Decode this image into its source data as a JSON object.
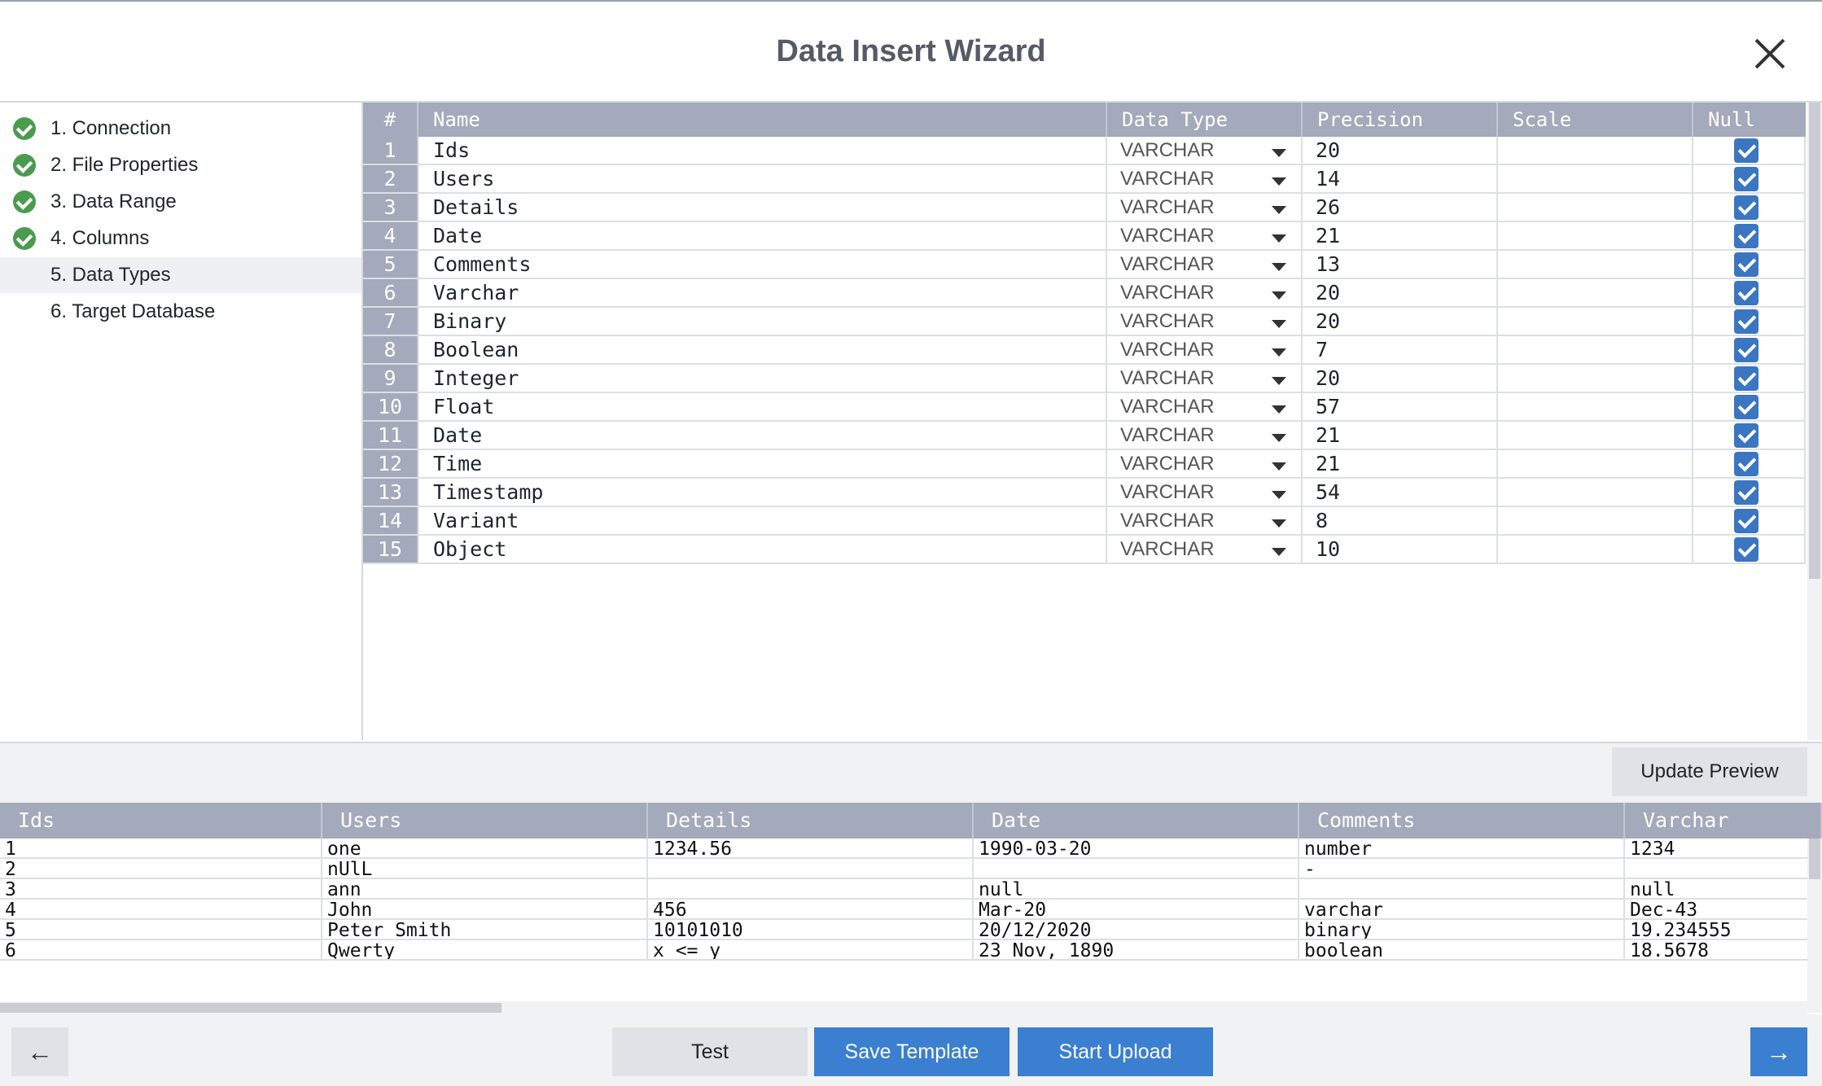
{
  "window": {
    "title": "Data Insert Wizard"
  },
  "steps": [
    {
      "label": "1. Connection",
      "done": true
    },
    {
      "label": "2. File Properties",
      "done": true
    },
    {
      "label": "3. Data Range",
      "done": true
    },
    {
      "label": "4. Columns",
      "done": true
    },
    {
      "label": "5. Data Types",
      "done": false,
      "active": true
    },
    {
      "label": "6. Target Database",
      "done": false
    }
  ],
  "columns_grid": {
    "headers": {
      "num": "#",
      "name": "Name",
      "type": "Data Type",
      "precision": "Precision",
      "scale": "Scale",
      "null": "Null"
    },
    "rows": [
      {
        "num": "1",
        "name": "Ids",
        "type": "VARCHAR",
        "precision": "20",
        "scale": "",
        "null": true
      },
      {
        "num": "2",
        "name": "Users",
        "type": "VARCHAR",
        "precision": "14",
        "scale": "",
        "null": true
      },
      {
        "num": "3",
        "name": "Details",
        "type": "VARCHAR",
        "precision": "26",
        "scale": "",
        "null": true
      },
      {
        "num": "4",
        "name": "Date",
        "type": "VARCHAR",
        "precision": "21",
        "scale": "",
        "null": true
      },
      {
        "num": "5",
        "name": "Comments",
        "type": "VARCHAR",
        "precision": "13",
        "scale": "",
        "null": true
      },
      {
        "num": "6",
        "name": "Varchar",
        "type": "VARCHAR",
        "precision": "20",
        "scale": "",
        "null": true
      },
      {
        "num": "7",
        "name": "Binary",
        "type": "VARCHAR",
        "precision": "20",
        "scale": "",
        "null": true
      },
      {
        "num": "8",
        "name": "Boolean",
        "type": "VARCHAR",
        "precision": "7",
        "scale": "",
        "null": true
      },
      {
        "num": "9",
        "name": "Integer",
        "type": "VARCHAR",
        "precision": "20",
        "scale": "",
        "null": true
      },
      {
        "num": "10",
        "name": "Float",
        "type": "VARCHAR",
        "precision": "57",
        "scale": "",
        "null": true
      },
      {
        "num": "11",
        "name": "Date",
        "type": "VARCHAR",
        "precision": "21",
        "scale": "",
        "null": true
      },
      {
        "num": "12",
        "name": "Time",
        "type": "VARCHAR",
        "precision": "21",
        "scale": "",
        "null": true
      },
      {
        "num": "13",
        "name": "Timestamp",
        "type": "VARCHAR",
        "precision": "54",
        "scale": "",
        "null": true
      },
      {
        "num": "14",
        "name": "Variant",
        "type": "VARCHAR",
        "precision": "8",
        "scale": "",
        "null": true
      },
      {
        "num": "15",
        "name": "Object",
        "type": "VARCHAR",
        "precision": "10",
        "scale": "",
        "null": true
      }
    ]
  },
  "update_preview_label": "Update Preview",
  "preview": {
    "headers": [
      "Ids",
      "Users",
      "Details",
      "Date",
      "Comments",
      "Varchar"
    ],
    "rows": [
      [
        "1",
        "one",
        "1234.56",
        "1990-03-20",
        "number",
        "1234"
      ],
      [
        "2",
        "nUlL",
        "",
        "",
        "-",
        ""
      ],
      [
        "3",
        "ann",
        "",
        "null",
        "",
        "null"
      ],
      [
        "4",
        "John",
        "456",
        "Mar-20",
        "varchar",
        "Dec-43"
      ],
      [
        "5",
        "Peter Smith",
        "10101010",
        "20/12/2020",
        "binary",
        "19.234555"
      ],
      [
        "6",
        "Qwerty",
        "x <= y",
        "23 Nov, 1890",
        "boolean",
        "18.5678"
      ]
    ]
  },
  "footer": {
    "back_icon": "←",
    "test_label": "Test",
    "save_template_label": "Save Template",
    "start_upload_label": "Start Upload",
    "next_icon": "→"
  },
  "colors": {
    "accent": "#3a7fd0",
    "header_bg": "#a4a9bb",
    "success": "#4b9b4f"
  }
}
